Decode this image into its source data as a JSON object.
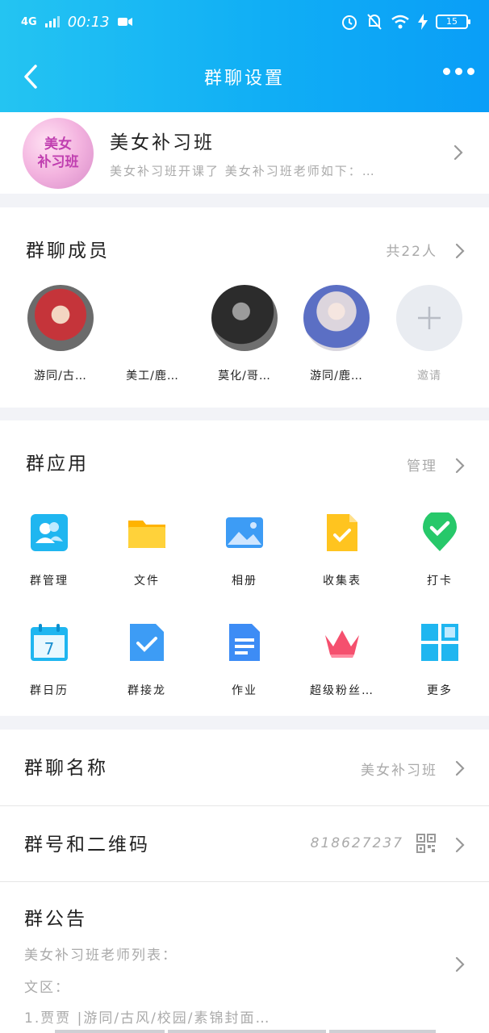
{
  "status_bar": {
    "network": "4G",
    "time": "00:13",
    "battery": "15"
  },
  "nav": {
    "title": "群聊设置"
  },
  "group": {
    "avatar_text_1": "美女",
    "avatar_text_2": "补习班",
    "name": "美女补习班",
    "subtitle": "美女补习班开课了  美女补习班老师如下：…"
  },
  "members": {
    "title": "群聊成员",
    "count": "共22人",
    "list": [
      {
        "name": "游同/古…"
      },
      {
        "name": "美工/鹿…"
      },
      {
        "name": "莫化/哥…"
      },
      {
        "name": "游同/鹿…"
      }
    ],
    "invite": "邀请"
  },
  "apps": {
    "title": "群应用",
    "manage": "管理",
    "items": [
      {
        "label": "群管理",
        "icon": "group-manage-icon",
        "color": "#1fb6f0"
      },
      {
        "label": "文件",
        "icon": "folder-icon",
        "color": "#ffc41f"
      },
      {
        "label": "相册",
        "icon": "album-icon",
        "color": "#3d9cf5"
      },
      {
        "label": "收集表",
        "icon": "collect-form-icon",
        "color": "#ffc41f"
      },
      {
        "label": "打卡",
        "icon": "checkin-icon",
        "color": "#27c86a"
      },
      {
        "label": "群日历",
        "icon": "calendar-icon",
        "color": "#1fb6f0"
      },
      {
        "label": "群接龙",
        "icon": "relay-icon",
        "color": "#3d9cf5"
      },
      {
        "label": "作业",
        "icon": "homework-icon",
        "color": "#3d8cf5"
      },
      {
        "label": "超级粉丝…",
        "icon": "crown-icon",
        "color": "#f5506e"
      },
      {
        "label": "更多",
        "icon": "more-grid-icon",
        "color": "#1fb6f0"
      }
    ]
  },
  "settings": {
    "name_label": "群聊名称",
    "name_value": "美女补习班",
    "number_label": "群号和二维码",
    "number_value": "818627237",
    "notice_label": "群公告",
    "notice_lines": [
      "美女补习班老师列表：",
      "文区：",
      "1.贾贾        |游同/古风/校园/素锦封面…"
    ]
  }
}
